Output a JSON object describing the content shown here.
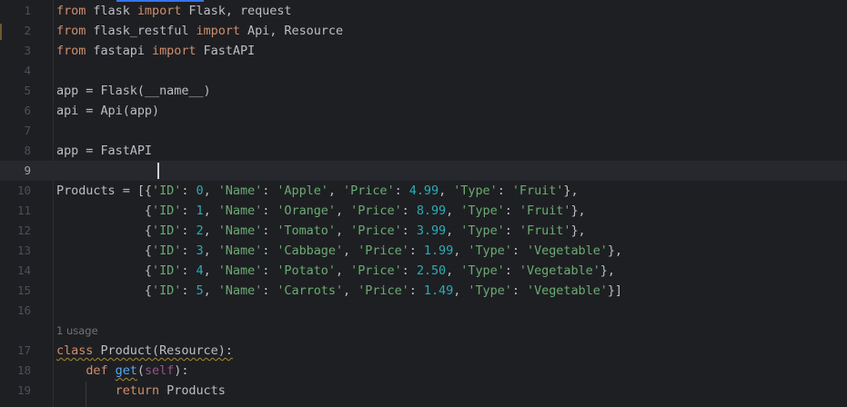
{
  "editor": {
    "inlay_hint": "1 usage",
    "current_line": 9,
    "lines": [
      {
        "num": "1",
        "tokens": [
          {
            "t": "from",
            "c": "kw"
          },
          {
            "t": " flask ",
            "c": "plain"
          },
          {
            "t": "import",
            "c": "kw"
          },
          {
            "t": " Flask, request",
            "c": "plain"
          }
        ]
      },
      {
        "num": "2",
        "tokens": [
          {
            "t": "from",
            "c": "kw"
          },
          {
            "t": " flask_restful ",
            "c": "plain"
          },
          {
            "t": "import",
            "c": "kw"
          },
          {
            "t": " Api, Resource",
            "c": "plain"
          }
        ]
      },
      {
        "num": "3",
        "tokens": [
          {
            "t": "from",
            "c": "kw"
          },
          {
            "t": " fastapi ",
            "c": "plain"
          },
          {
            "t": "import",
            "c": "kw"
          },
          {
            "t": " FastAPI",
            "c": "plain"
          }
        ]
      },
      {
        "num": "4",
        "tokens": []
      },
      {
        "num": "5",
        "tokens": [
          {
            "t": "app = Flask(__name__)",
            "c": "plain"
          }
        ]
      },
      {
        "num": "6",
        "tokens": [
          {
            "t": "api = Api(app)",
            "c": "plain"
          }
        ]
      },
      {
        "num": "7",
        "tokens": []
      },
      {
        "num": "8",
        "tokens": [
          {
            "t": "app = FastAPI",
            "c": "plain"
          }
        ]
      },
      {
        "num": "9",
        "tokens": []
      },
      {
        "num": "10",
        "tokens": [
          {
            "t": "Products = [{",
            "c": "plain"
          },
          {
            "t": "'ID'",
            "c": "str"
          },
          {
            "t": ": ",
            "c": "plain"
          },
          {
            "t": "0",
            "c": "num"
          },
          {
            "t": ", ",
            "c": "plain"
          },
          {
            "t": "'Name'",
            "c": "str"
          },
          {
            "t": ": ",
            "c": "plain"
          },
          {
            "t": "'Apple'",
            "c": "str"
          },
          {
            "t": ", ",
            "c": "plain"
          },
          {
            "t": "'Price'",
            "c": "str"
          },
          {
            "t": ": ",
            "c": "plain"
          },
          {
            "t": "4.99",
            "c": "num"
          },
          {
            "t": ", ",
            "c": "plain"
          },
          {
            "t": "'Type'",
            "c": "str"
          },
          {
            "t": ": ",
            "c": "plain"
          },
          {
            "t": "'Fruit'",
            "c": "str"
          },
          {
            "t": "},",
            "c": "plain"
          }
        ]
      },
      {
        "num": "11",
        "tokens": [
          {
            "t": "            {",
            "c": "plain"
          },
          {
            "t": "'ID'",
            "c": "str"
          },
          {
            "t": ": ",
            "c": "plain"
          },
          {
            "t": "1",
            "c": "num"
          },
          {
            "t": ", ",
            "c": "plain"
          },
          {
            "t": "'Name'",
            "c": "str"
          },
          {
            "t": ": ",
            "c": "plain"
          },
          {
            "t": "'Orange'",
            "c": "str"
          },
          {
            "t": ", ",
            "c": "plain"
          },
          {
            "t": "'Price'",
            "c": "str"
          },
          {
            "t": ": ",
            "c": "plain"
          },
          {
            "t": "8.99",
            "c": "num"
          },
          {
            "t": ", ",
            "c": "plain"
          },
          {
            "t": "'Type'",
            "c": "str"
          },
          {
            "t": ": ",
            "c": "plain"
          },
          {
            "t": "'Fruit'",
            "c": "str"
          },
          {
            "t": "},",
            "c": "plain"
          }
        ]
      },
      {
        "num": "12",
        "tokens": [
          {
            "t": "            {",
            "c": "plain"
          },
          {
            "t": "'ID'",
            "c": "str"
          },
          {
            "t": ": ",
            "c": "plain"
          },
          {
            "t": "2",
            "c": "num"
          },
          {
            "t": ", ",
            "c": "plain"
          },
          {
            "t": "'Name'",
            "c": "str"
          },
          {
            "t": ": ",
            "c": "plain"
          },
          {
            "t": "'Tomato'",
            "c": "str"
          },
          {
            "t": ", ",
            "c": "plain"
          },
          {
            "t": "'Price'",
            "c": "str"
          },
          {
            "t": ": ",
            "c": "plain"
          },
          {
            "t": "3.99",
            "c": "num"
          },
          {
            "t": ", ",
            "c": "plain"
          },
          {
            "t": "'Type'",
            "c": "str"
          },
          {
            "t": ": ",
            "c": "plain"
          },
          {
            "t": "'Fruit'",
            "c": "str"
          },
          {
            "t": "},",
            "c": "plain"
          }
        ]
      },
      {
        "num": "13",
        "tokens": [
          {
            "t": "            {",
            "c": "plain"
          },
          {
            "t": "'ID'",
            "c": "str"
          },
          {
            "t": ": ",
            "c": "plain"
          },
          {
            "t": "3",
            "c": "num"
          },
          {
            "t": ", ",
            "c": "plain"
          },
          {
            "t": "'Name'",
            "c": "str"
          },
          {
            "t": ": ",
            "c": "plain"
          },
          {
            "t": "'Cabbage'",
            "c": "str"
          },
          {
            "t": ", ",
            "c": "plain"
          },
          {
            "t": "'Price'",
            "c": "str"
          },
          {
            "t": ": ",
            "c": "plain"
          },
          {
            "t": "1.99",
            "c": "num"
          },
          {
            "t": ", ",
            "c": "plain"
          },
          {
            "t": "'Type'",
            "c": "str"
          },
          {
            "t": ": ",
            "c": "plain"
          },
          {
            "t": "'Vegetable'",
            "c": "str"
          },
          {
            "t": "},",
            "c": "plain"
          }
        ]
      },
      {
        "num": "14",
        "tokens": [
          {
            "t": "            {",
            "c": "plain"
          },
          {
            "t": "'ID'",
            "c": "str"
          },
          {
            "t": ": ",
            "c": "plain"
          },
          {
            "t": "4",
            "c": "num"
          },
          {
            "t": ", ",
            "c": "plain"
          },
          {
            "t": "'Name'",
            "c": "str"
          },
          {
            "t": ": ",
            "c": "plain"
          },
          {
            "t": "'Potato'",
            "c": "str"
          },
          {
            "t": ", ",
            "c": "plain"
          },
          {
            "t": "'Price'",
            "c": "str"
          },
          {
            "t": ": ",
            "c": "plain"
          },
          {
            "t": "2.50",
            "c": "num"
          },
          {
            "t": ", ",
            "c": "plain"
          },
          {
            "t": "'Type'",
            "c": "str"
          },
          {
            "t": ": ",
            "c": "plain"
          },
          {
            "t": "'Vegetable'",
            "c": "str"
          },
          {
            "t": "},",
            "c": "plain"
          }
        ]
      },
      {
        "num": "15",
        "tokens": [
          {
            "t": "            {",
            "c": "plain"
          },
          {
            "t": "'ID'",
            "c": "str"
          },
          {
            "t": ": ",
            "c": "plain"
          },
          {
            "t": "5",
            "c": "num"
          },
          {
            "t": ", ",
            "c": "plain"
          },
          {
            "t": "'Name'",
            "c": "str"
          },
          {
            "t": ": ",
            "c": "plain"
          },
          {
            "t": "'Carrots'",
            "c": "str"
          },
          {
            "t": ", ",
            "c": "plain"
          },
          {
            "t": "'Price'",
            "c": "str"
          },
          {
            "t": ": ",
            "c": "plain"
          },
          {
            "t": "1.49",
            "c": "num"
          },
          {
            "t": ", ",
            "c": "plain"
          },
          {
            "t": "'Type'",
            "c": "str"
          },
          {
            "t": ": ",
            "c": "plain"
          },
          {
            "t": "'Vegetable'",
            "c": "str"
          },
          {
            "t": "}]",
            "c": "plain"
          }
        ]
      },
      {
        "num": "16",
        "tokens": []
      },
      {
        "num": "17",
        "tokens": [
          {
            "t": "class",
            "c": "kw squig"
          },
          {
            "t": " Product(Resource):",
            "c": "plain squig"
          }
        ]
      },
      {
        "num": "18",
        "tokens": [
          {
            "t": "    ",
            "c": "plain"
          },
          {
            "t": "def",
            "c": "kw"
          },
          {
            "t": " ",
            "c": "plain"
          },
          {
            "t": "get",
            "c": "fn squig"
          },
          {
            "t": "(",
            "c": "plain"
          },
          {
            "t": "self",
            "c": "self"
          },
          {
            "t": "):",
            "c": "plain"
          }
        ]
      },
      {
        "num": "19",
        "tokens": [
          {
            "t": "        ",
            "c": "plain"
          },
          {
            "t": "return",
            "c": "kw"
          },
          {
            "t": " Products",
            "c": "plain"
          }
        ]
      }
    ]
  }
}
